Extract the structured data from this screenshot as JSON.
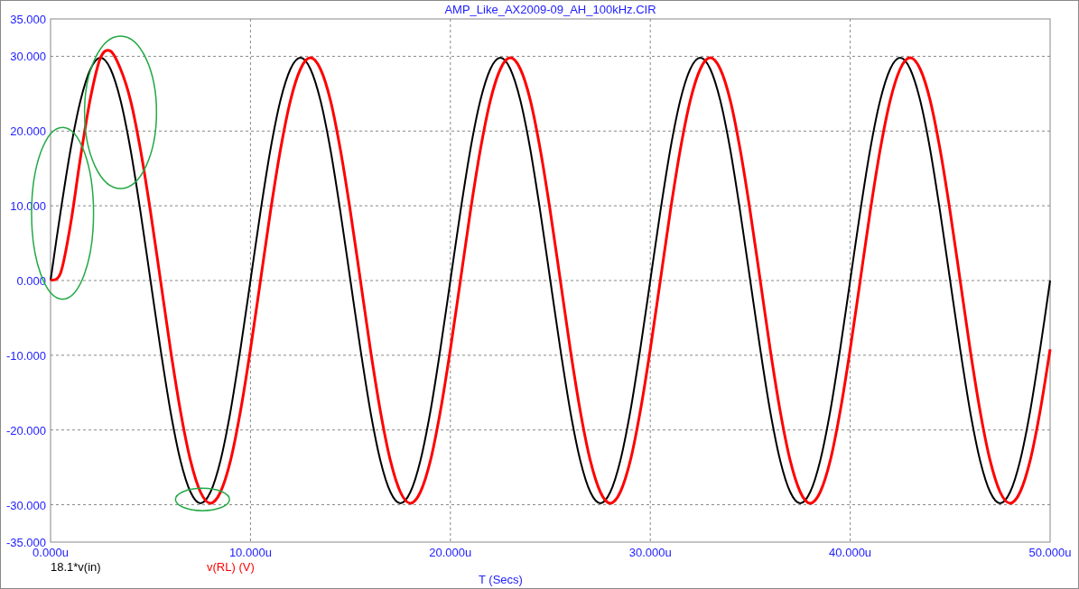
{
  "plot": {
    "chart_data": {
      "type": "line",
      "grid": true,
      "title": "AMP_Like_AX2009-09_AH_100kHz.CIR",
      "xlabel": "T (Secs)",
      "xlim": [
        0,
        50
      ],
      "ylim": [
        -35,
        35
      ],
      "xticks": [
        {
          "value": 0,
          "label": "0.000u"
        },
        {
          "value": 10,
          "label": "10.000u"
        },
        {
          "value": 20,
          "label": "20.000u"
        },
        {
          "value": 30,
          "label": "30.000u"
        },
        {
          "value": 40,
          "label": "40.000u"
        },
        {
          "value": 50,
          "label": "50.000u"
        }
      ],
      "yticks": [
        {
          "value": 35,
          "label": "35.000"
        },
        {
          "value": 30,
          "label": "30.000"
        },
        {
          "value": 20,
          "label": "20.000"
        },
        {
          "value": 10,
          "label": "10.000"
        },
        {
          "value": 0,
          "label": "0.000"
        },
        {
          "value": -10,
          "label": "-10.000"
        },
        {
          "value": -20,
          "label": "-20.000"
        },
        {
          "value": -30,
          "label": "-30.000"
        },
        {
          "value": -35,
          "label": "-35.000"
        }
      ],
      "x": [
        0,
        0.5,
        1,
        1.5,
        2,
        2.5,
        3,
        3.5,
        4,
        4.5,
        5,
        5.5,
        6,
        6.5,
        7,
        7.5,
        8,
        8.5,
        9,
        9.5,
        10,
        10.5,
        11,
        11.5,
        12,
        12.5,
        13,
        13.5,
        14,
        14.5,
        15,
        15.5,
        16,
        16.5,
        17,
        17.5,
        18,
        18.5,
        19,
        19.5,
        20,
        20.5,
        21,
        21.5,
        22,
        22.5,
        23,
        23.5,
        24,
        24.5,
        25,
        25.5,
        26,
        26.5,
        27,
        27.5,
        28,
        28.5,
        29,
        29.5,
        30,
        30.5,
        31,
        31.5,
        32,
        32.5,
        33,
        33.5,
        34,
        34.5,
        35,
        35.5,
        36,
        36.5,
        37,
        37.5,
        38,
        38.5,
        39,
        39.5,
        40,
        40.5,
        41,
        41.5,
        42,
        42.5,
        43,
        43.5,
        44,
        44.5,
        45,
        45.5,
        46,
        46.5,
        47,
        47.5,
        48,
        48.5,
        49,
        49.5,
        50
      ],
      "series": [
        {
          "name": "18.1*v(in)",
          "color": "#000000",
          "values": [
            0,
            9.2,
            17.5,
            24.1,
            28.3,
            29.8,
            28.3,
            24.1,
            17.5,
            9.2,
            0,
            -9.2,
            -17.5,
            -24.1,
            -28.3,
            -29.8,
            -28.3,
            -24.1,
            -17.5,
            -9.2,
            0,
            9.2,
            17.5,
            24.1,
            28.3,
            29.8,
            28.3,
            24.1,
            17.5,
            9.2,
            0,
            -9.2,
            -17.5,
            -24.1,
            -28.3,
            -29.8,
            -28.3,
            -24.1,
            -17.5,
            -9.2,
            0,
            9.2,
            17.5,
            24.1,
            28.3,
            29.8,
            28.3,
            24.1,
            17.5,
            9.2,
            0,
            -9.2,
            -17.5,
            -24.1,
            -28.3,
            -29.8,
            -28.3,
            -24.1,
            -17.5,
            -9.2,
            0,
            9.2,
            17.5,
            24.1,
            28.3,
            29.8,
            28.3,
            24.1,
            17.5,
            9.2,
            0,
            -9.2,
            -17.5,
            -24.1,
            -28.3,
            -29.8,
            -28.3,
            -24.1,
            -17.5,
            -9.2,
            0,
            9.2,
            17.5,
            24.1,
            28.3,
            29.8,
            28.3,
            24.1,
            17.5,
            9.2,
            0,
            -9.2,
            -17.5,
            -24.1,
            -28.3,
            -29.8,
            -28.3,
            -24.1,
            -17.5,
            -9.2,
            0
          ]
        },
        {
          "name": "v(RL) (V)",
          "color": "#ff0000",
          "values": [
            0,
            1,
            7.5,
            16.5,
            24.5,
            29.8,
            30.7,
            28.3,
            24.1,
            17.5,
            9.2,
            0,
            -9.2,
            -17.5,
            -24.1,
            -28.3,
            -29.8,
            -28.3,
            -24.1,
            -17.5,
            -9.2,
            0,
            9.2,
            17.5,
            24.1,
            28.3,
            29.8,
            28.3,
            24.1,
            17.5,
            9.2,
            0,
            -9.2,
            -17.5,
            -24.1,
            -28.3,
            -29.8,
            -28.3,
            -24.1,
            -17.5,
            -9.2,
            0,
            9.2,
            17.5,
            24.1,
            28.3,
            29.8,
            28.3,
            24.1,
            17.5,
            9.2,
            0,
            -9.2,
            -17.5,
            -24.1,
            -28.3,
            -29.8,
            -28.3,
            -24.1,
            -17.5,
            -9.2,
            0,
            9.2,
            17.5,
            24.1,
            28.3,
            29.8,
            28.3,
            24.1,
            17.5,
            9.2,
            0,
            -9.2,
            -17.5,
            -24.1,
            -28.3,
            -29.8,
            -28.3,
            -24.1,
            -17.5,
            -9.2,
            0,
            9.2,
            17.5,
            24.1,
            28.3,
            29.8,
            28.3,
            24.1,
            17.5,
            9.2,
            0,
            -9.2,
            -17.5,
            -24.1,
            -28.3,
            -29.8,
            -28.3,
            -24.1,
            -17.5,
            -9.2
          ]
        }
      ]
    }
  }
}
